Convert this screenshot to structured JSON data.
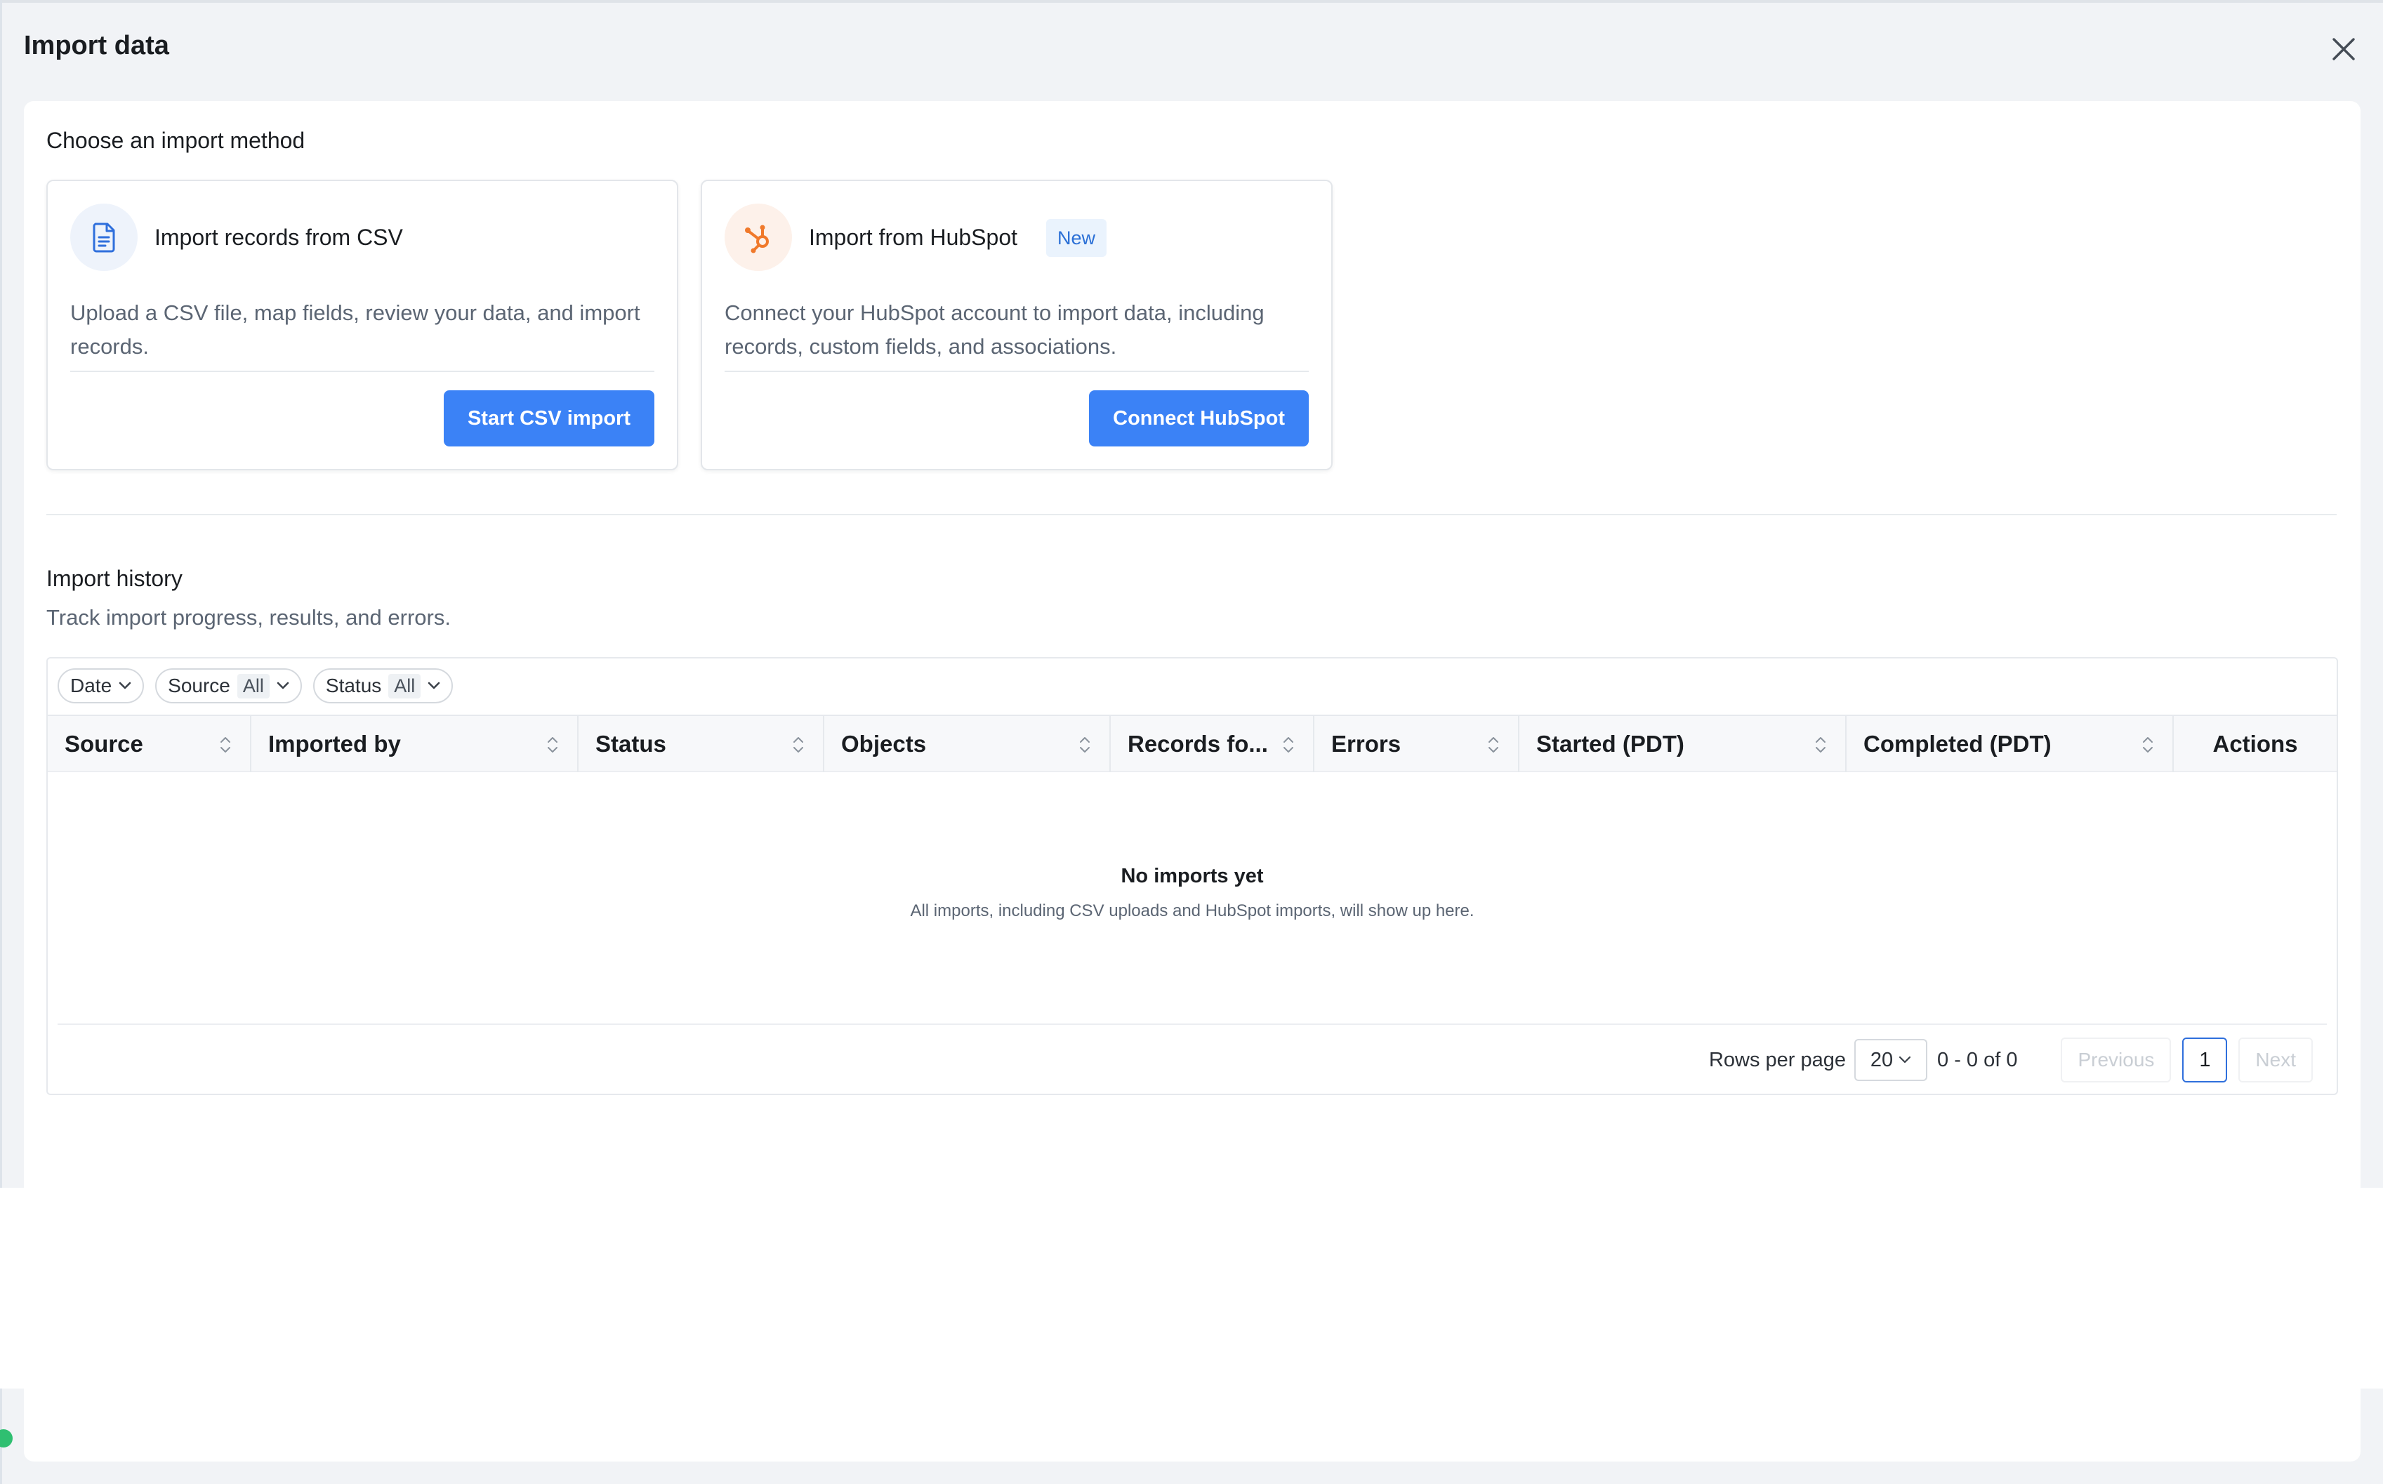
{
  "modal": {
    "title": "Import data"
  },
  "methods": {
    "heading": "Choose an import method",
    "csv": {
      "title": "Import records from CSV",
      "description": "Upload a CSV file, map fields, review your data, and import records.",
      "button": "Start CSV import",
      "icon": "document-icon"
    },
    "hubspot": {
      "title": "Import from HubSpot",
      "badge": "New",
      "description": "Connect your HubSpot account to import data, including records, custom fields, and associations.",
      "button": "Connect HubSpot",
      "icon": "hubspot-icon"
    }
  },
  "history": {
    "heading": "Import history",
    "subheading": "Track import progress, results, and errors.",
    "filters": {
      "date": "Date",
      "source": "Source",
      "source_value": "All",
      "status": "Status",
      "status_value": "All"
    },
    "columns": [
      "Source",
      "Imported by",
      "Status",
      "Objects",
      "Records fo...",
      "Errors",
      "Started (PDT)",
      "Completed (PDT)",
      "Actions"
    ],
    "empty_title": "No imports yet",
    "empty_subtitle": "All imports, including CSV uploads and HubSpot imports, will show up here.",
    "pagination": {
      "rows_label": "Rows per page",
      "rows_value": "20",
      "range": "0 - 0 of 0",
      "previous": "Previous",
      "page": "1",
      "next": "Next"
    }
  },
  "colors": {
    "primary": "#3b82f6",
    "hubspot": "#f0792b",
    "badge_bg": "#eaf3fd"
  }
}
